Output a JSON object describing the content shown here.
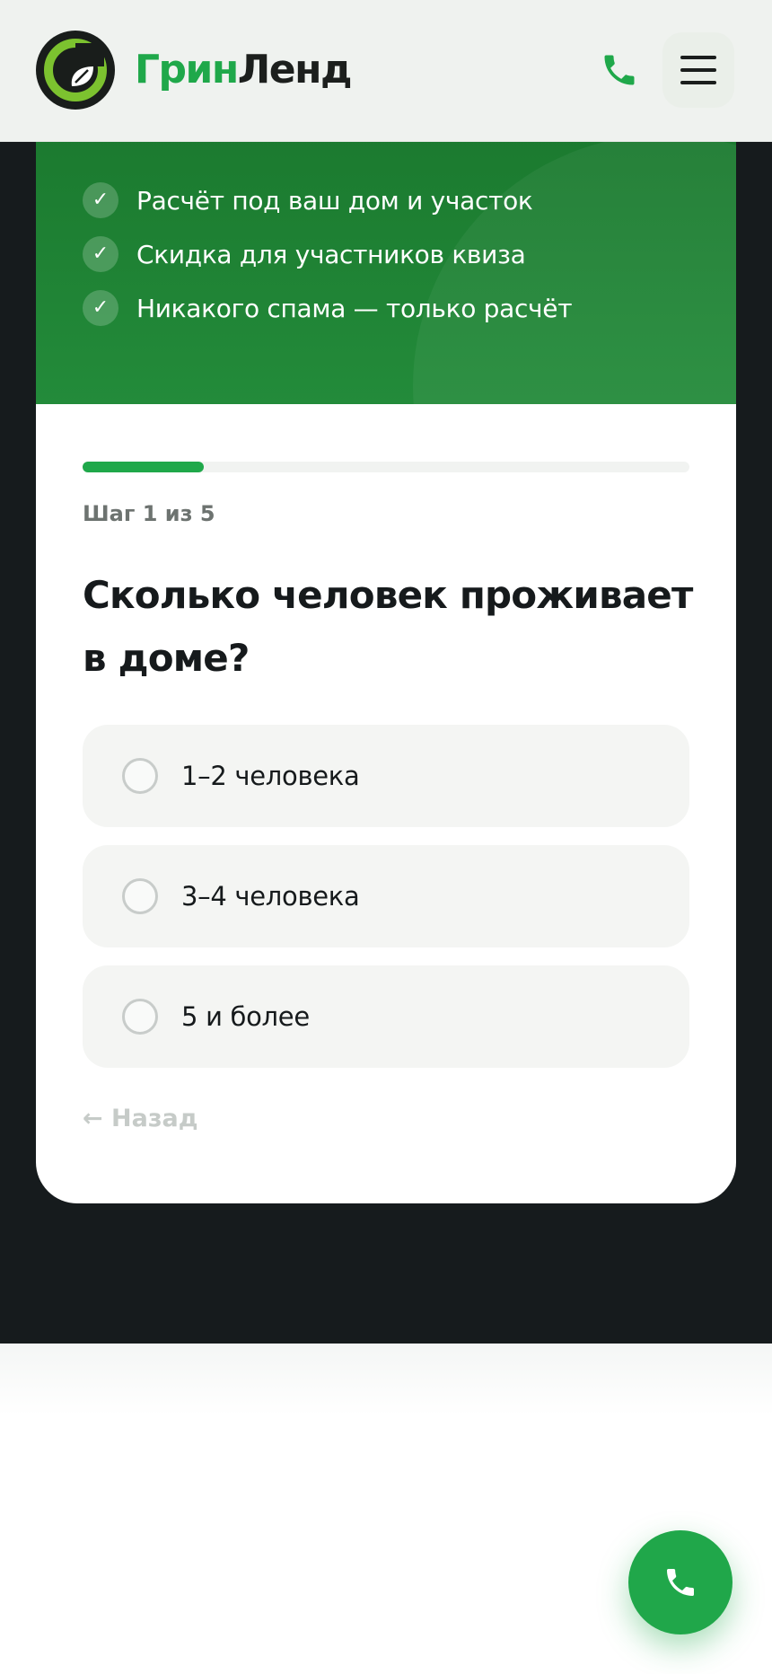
{
  "header": {
    "logo_icon": "greenland-leaf-logo",
    "brand_part1": "Грин",
    "brand_part2": "Ленд",
    "phone_icon": "phone-icon",
    "menu_icon": "hamburger-menu-icon"
  },
  "hero": {
    "benefits": [
      "Расчёт под ваш дом и участок",
      "Скидка для участников квиза",
      "Никакого спама — только расчёт"
    ],
    "check_icon": "check-icon"
  },
  "quiz": {
    "progress_fraction": 0.2,
    "step_label": "Шаг 1 из 5",
    "question": "Сколько человек проживает в доме?",
    "options": [
      "1–2 человека",
      "3–4 человека",
      "5 и более"
    ],
    "back_label": "← Назад"
  },
  "fab": {
    "icon": "phone-icon"
  },
  "colors": {
    "accent": "#1fa84a",
    "hero_green": "#1f8636",
    "dark_background": "#161b1d"
  }
}
